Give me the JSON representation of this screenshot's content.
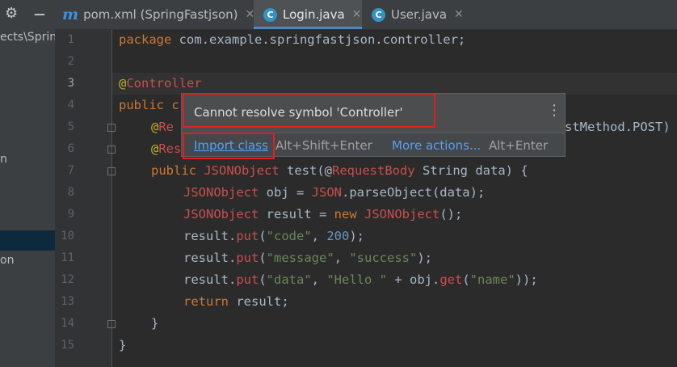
{
  "sidebar": {
    "path_text": "ects\\Sprin",
    "frag_1": "n",
    "frag_2": "on"
  },
  "tabs": [
    {
      "label": "pom.xml (SpringFastjson)",
      "icon": "maven-icon",
      "icon_glyph": "m",
      "active": false
    },
    {
      "label": "Login.java",
      "icon": "class-icon",
      "icon_glyph": "C",
      "active": true
    },
    {
      "label": "User.java",
      "icon": "class-icon",
      "icon_glyph": "C",
      "active": false
    }
  ],
  "tab_close_glyph": "✕",
  "gear_glyph": "⚙",
  "minimize_glyph": "—",
  "line_numbers": [
    "1",
    "2",
    "3",
    "4",
    "5",
    "6",
    "7",
    "8",
    "9",
    "10",
    "11",
    "12",
    "13",
    "14",
    "15"
  ],
  "code": {
    "l1_kw": "package",
    "l1_rest": " com.example.springfastjson.controller;",
    "l3_at": "@",
    "l3_ann": "Controller",
    "l4_kw": "public",
    "l4_rest": " c",
    "l5_at": "@",
    "l5_ann": "Re",
    "l5_tail": "stMethod.POST)",
    "l6_at": "@",
    "l6_ann": "Res",
    "l7_kw": "public",
    "l7_type": "JSONObject",
    "l7_meth": "test",
    "l7_p1": "(@",
    "l7_ann": "RequestBody",
    "l7_p2": " String data) {",
    "l8_type": "JSONObject",
    "l8_mid": " obj = ",
    "l8_json": "JSON",
    "l8_end": ".parseObject(data);",
    "l9_type": "JSONObject",
    "l9_mid": " result = ",
    "l9_new": "new",
    "l9_type2": "JSONObject",
    "l9_end": "();",
    "put": "put",
    "l10_a": "result.",
    "l10_s": "\"code\"",
    "l10_n": "200",
    "l11_a": "result.",
    "l11_s1": "\"message\"",
    "l11_s2": "\"success\"",
    "l12_a": "result.",
    "l12_s1": "\"data\"",
    "l12_s2": "\"Hello \"",
    "l12_mid": " + obj.",
    "l12_get": "get",
    "l12_s3": "\"name\"",
    "l13_kw": "return",
    "l13_rest": " result;",
    "l14": "}",
    "l15": "}"
  },
  "popup": {
    "message": "Cannot resolve symbol 'Controller'",
    "menu_glyph": "⋮",
    "import_label": "Import class",
    "import_shortcut": "Alt+Shift+Enter",
    "more_label": "More actions...",
    "more_shortcut": "Alt+Enter"
  },
  "colors": {
    "highlight_box": "#e02020",
    "link": "#589df6",
    "error_symbol": "#c94f4f"
  }
}
